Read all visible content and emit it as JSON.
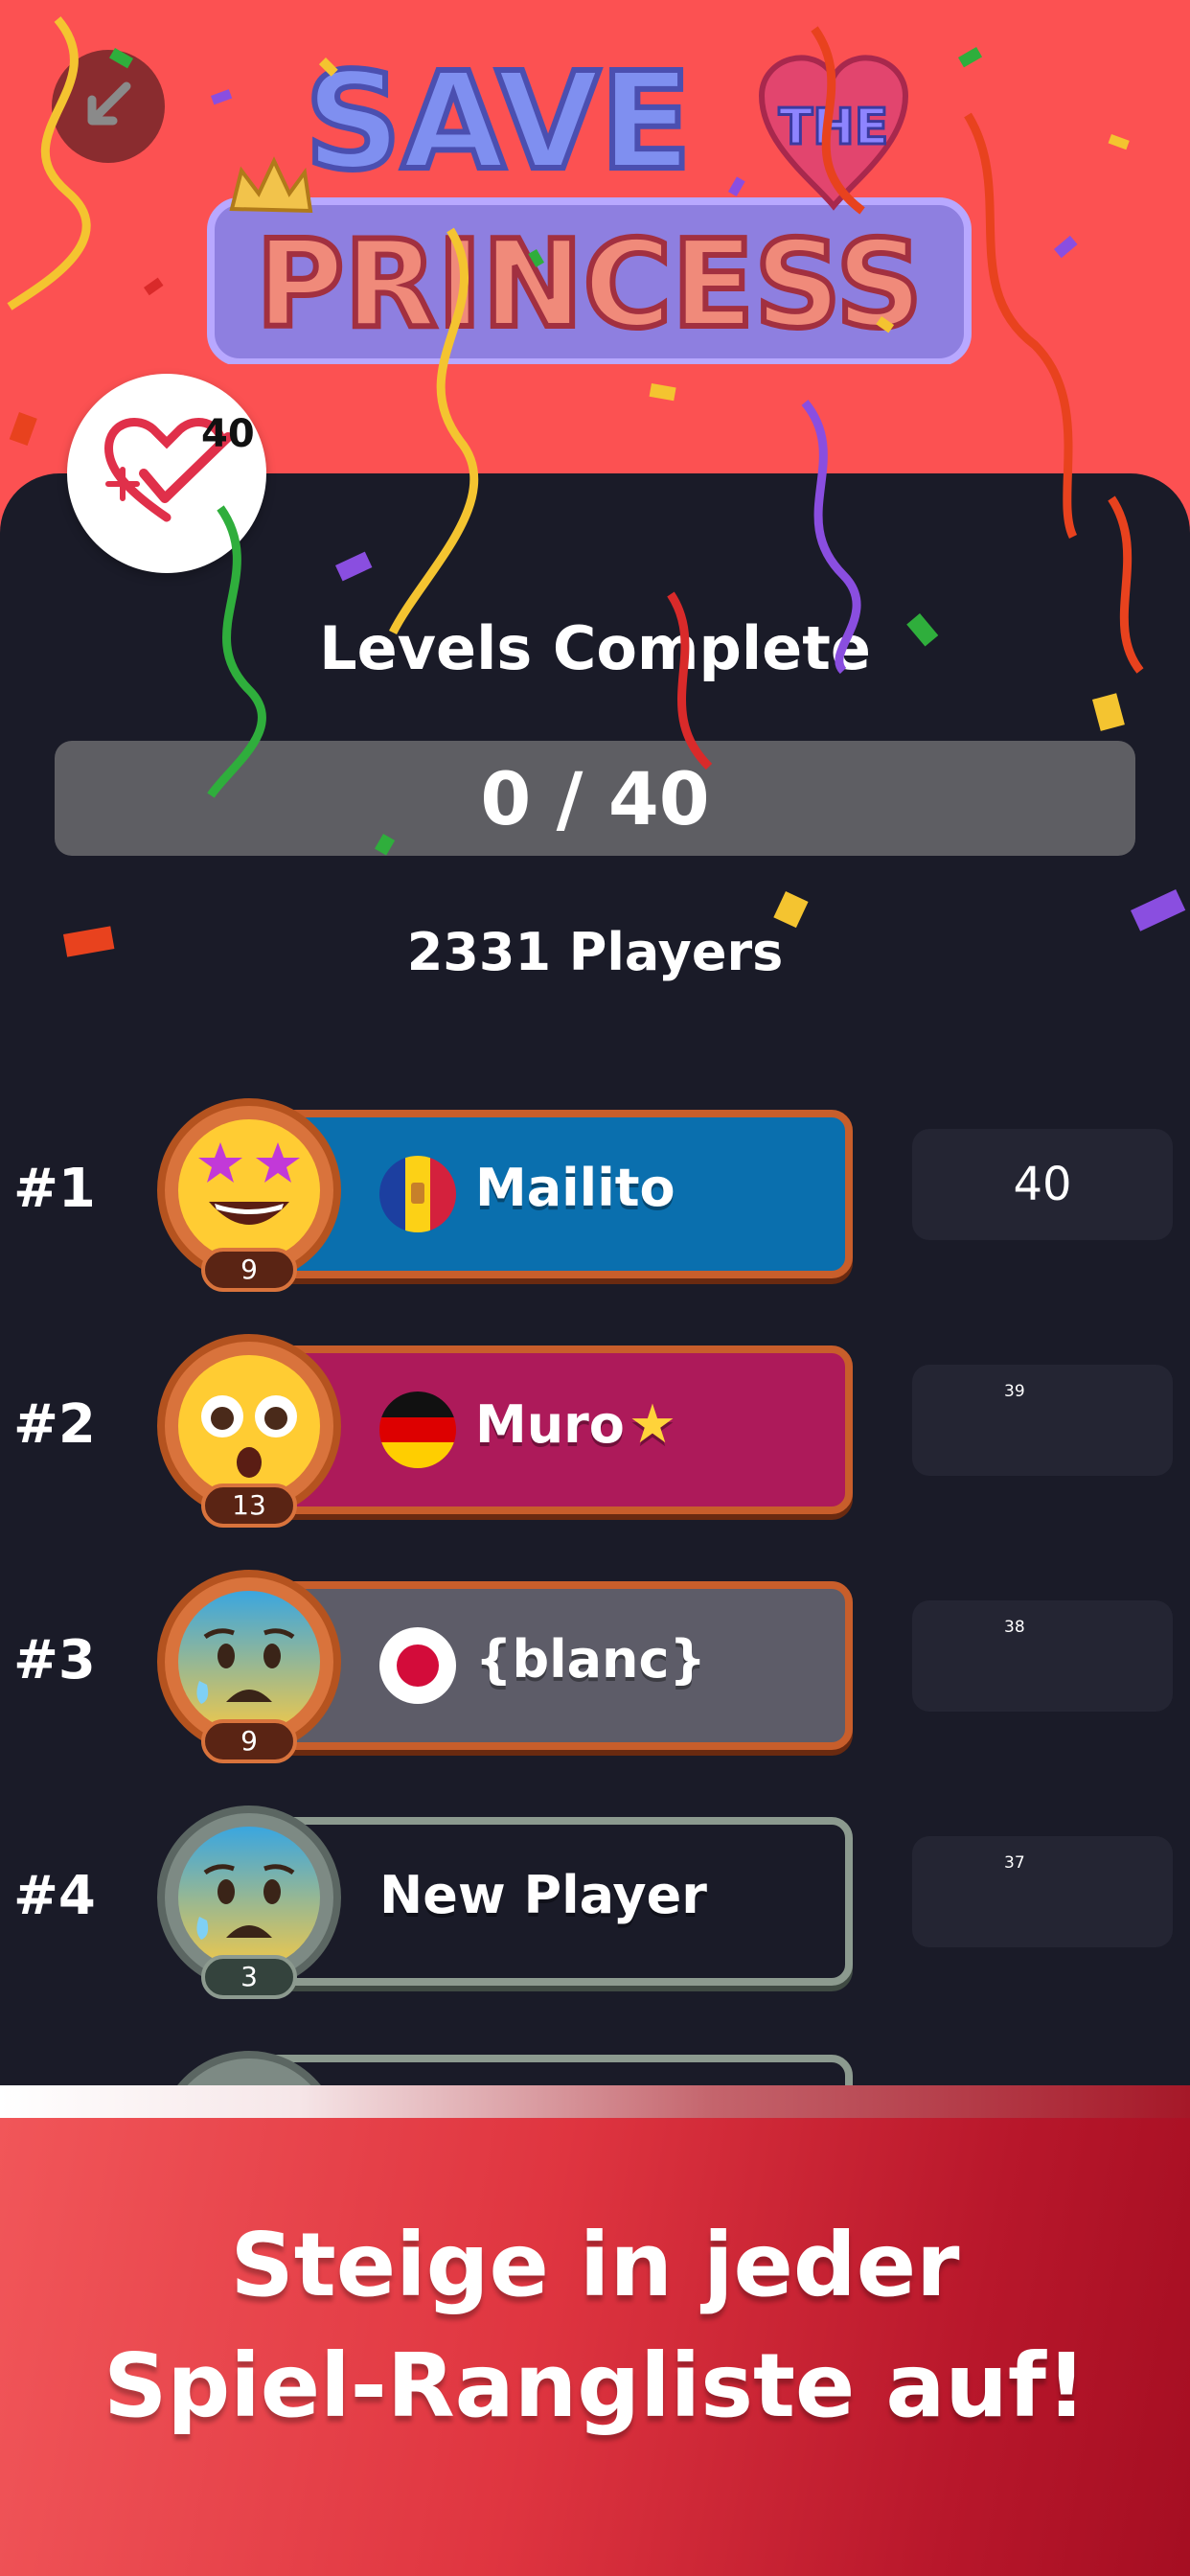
{
  "header": {
    "logo_line1": "SAVE",
    "logo_the": "THE",
    "logo_line2": "PRINCESS"
  },
  "hearts": {
    "count": "40"
  },
  "levels": {
    "title": "Levels Complete",
    "progress_text": "0 / 40",
    "completed_fraction": 0.0
  },
  "players": {
    "count_label": "2331 Players"
  },
  "leaderboard": [
    {
      "rank": "#1",
      "name": "Mailito",
      "flag": "andorra",
      "level": "9",
      "score": "40",
      "card": "blue",
      "avatar": "star-struck-face"
    },
    {
      "rank": "#2",
      "name": "Muro",
      "flag": "germany",
      "level": "13",
      "score": "39",
      "card": "magenta",
      "avatar": "flushed-face"
    },
    {
      "rank": "#3",
      "name": "{blanc}",
      "flag": "japan",
      "level": "9",
      "score": "38",
      "card": "gray",
      "avatar": "anxious-sweat-face"
    },
    {
      "rank": "#4",
      "name": "New Player",
      "flag": "",
      "level": "3",
      "score": "37",
      "card": "dark",
      "avatar": "anxious-sweat-face"
    }
  ],
  "promo": {
    "line1": "Steige in jeder",
    "line2": "Spiel-Rangliste auf!"
  },
  "colors": {
    "background_top": "#fc5152",
    "panel": "#1a1b28",
    "progress_track": "#5e5e63",
    "card_blue": "#0a6fae",
    "card_magenta": "#ad1a5a",
    "card_gray": "#5d5c68",
    "bronze_frame": "#c85e2b",
    "silver_frame": "#8c9a8f"
  }
}
